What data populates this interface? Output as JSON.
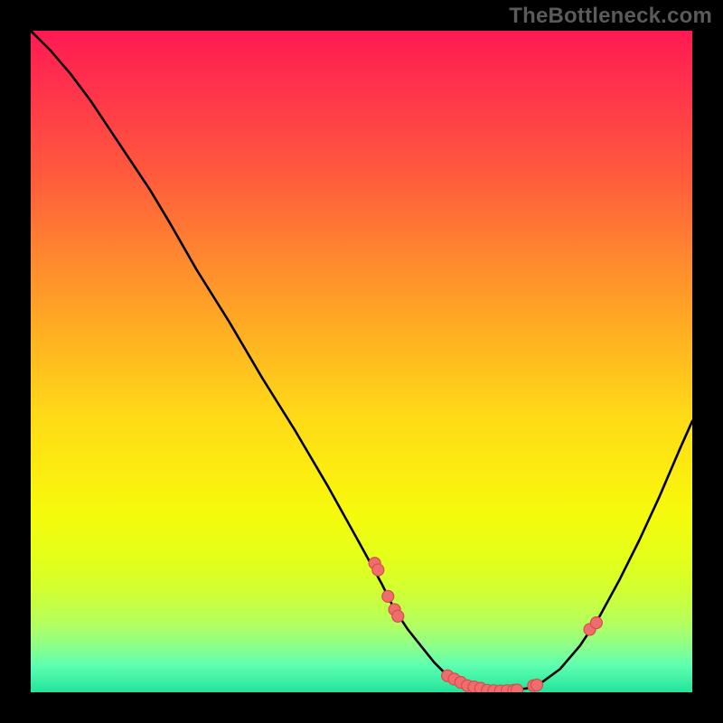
{
  "watermark": "TheBottleneck.com",
  "colors": {
    "background": "#000000",
    "gradient_top": "#ff1a52",
    "gradient_mid": "#ffd917",
    "gradient_bottom": "#22e39b",
    "curve": "#000000",
    "dot_fill": "#ef6d6d",
    "dot_stroke": "#d84c4c"
  },
  "chart_data": {
    "type": "line",
    "title": "",
    "xlabel": "",
    "ylabel": "",
    "xlim": [
      0,
      100
    ],
    "ylim": [
      0,
      100
    ],
    "x": [
      0,
      3,
      6,
      9,
      12,
      15,
      18,
      21,
      25,
      30,
      35,
      40,
      45,
      50,
      53,
      55,
      57,
      59,
      61,
      63,
      65,
      67,
      69,
      71,
      73,
      75,
      77,
      80,
      83,
      86,
      89,
      92,
      95,
      98,
      100
    ],
    "values": [
      100,
      97,
      93.5,
      89.5,
      85,
      80.5,
      76,
      71,
      64,
      56,
      47.5,
      39.5,
      31,
      22,
      16.5,
      12.5,
      9.5,
      7,
      4.5,
      2.5,
      1.5,
      0.8,
      0.3,
      0.2,
      0.3,
      0.6,
      1.3,
      3.5,
      7,
      11.5,
      17,
      23,
      29.5,
      36.5,
      41
    ],
    "markers_x": [
      52,
      52.5,
      54,
      55,
      55.5,
      63,
      64,
      65,
      66,
      67,
      68,
      69,
      70,
      71,
      72,
      73,
      73.5,
      76,
      76.5,
      84.5,
      85.5
    ],
    "markers_y": [
      19.5,
      18.5,
      14.5,
      12.5,
      11.5,
      2.5,
      2,
      1.5,
      1,
      0.8,
      0.6,
      0.3,
      0.25,
      0.2,
      0.25,
      0.3,
      0.35,
      1,
      1.1,
      9.5,
      10.5
    ]
  }
}
